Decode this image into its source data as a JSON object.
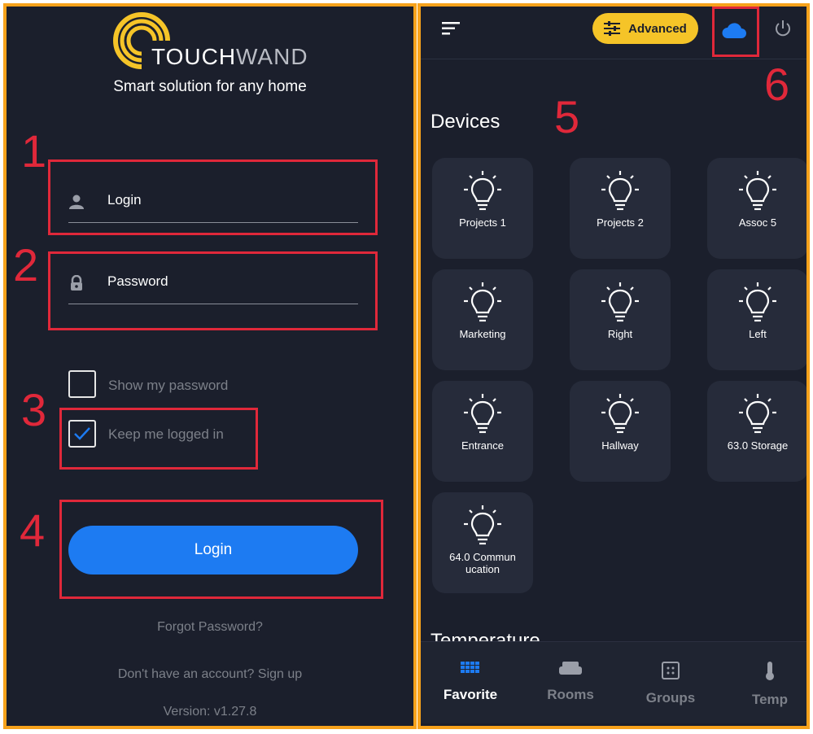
{
  "login": {
    "brand_part1": "TOUCH",
    "brand_part2": "WAND",
    "tagline": "Smart solution for any home",
    "login_placeholder": "Login",
    "password_placeholder": "Password",
    "show_password_label": "Show my password",
    "keep_logged_label": "Keep me logged in",
    "show_password_checked": false,
    "keep_logged_checked": true,
    "login_button": "Login",
    "forgot_password": "Forgot Password?",
    "signup": "Don't have an account? Sign up",
    "version": "Version: v1.27.8"
  },
  "annotations": [
    "1",
    "2",
    "3",
    "4",
    "5",
    "6"
  ],
  "dashboard": {
    "advanced_label": "Advanced",
    "devices_title": "Devices",
    "devices": [
      "Projects 1",
      "Projects 2",
      "Assoc 5",
      "Marketing",
      "Right",
      "Left",
      "Entrance",
      "Hallway",
      "63.0 Storage",
      "64.0 Commun ucation"
    ],
    "next_section_title": "Temperature",
    "nav": [
      {
        "label": "Favorite",
        "icon": "grid-icon",
        "active": true
      },
      {
        "label": "Rooms",
        "icon": "sofa-icon",
        "active": false
      },
      {
        "label": "Groups",
        "icon": "groups-icon",
        "active": false
      },
      {
        "label": "Temp",
        "icon": "thermometer-icon",
        "active": false
      }
    ]
  },
  "colors": {
    "panel_bg": "#1b1f2c",
    "border": "#f7a21b",
    "annotation": "#e0283a",
    "primary": "#1d7bf2",
    "advanced": "#f5c428",
    "tile_bg": "#262b3a"
  }
}
